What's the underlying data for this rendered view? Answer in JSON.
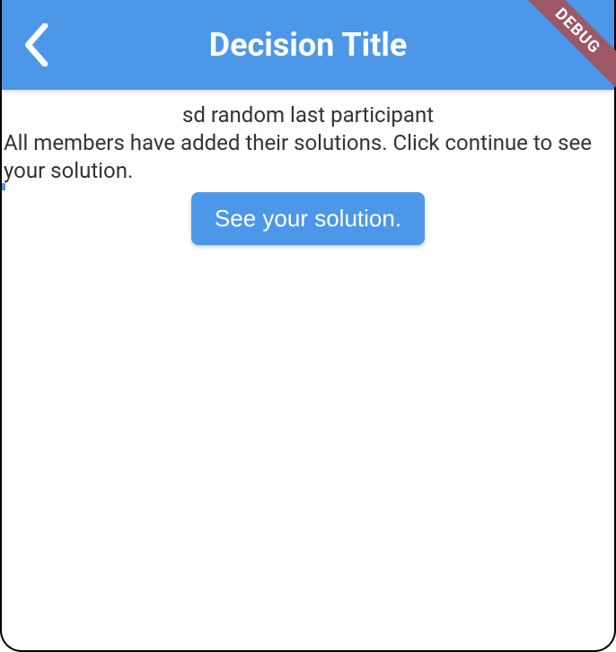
{
  "header": {
    "title": "Decision Title",
    "debug_label": "DEBUG"
  },
  "content": {
    "participant_line": "sd random last participant",
    "instruction": "All members have added their solutions. Click continue to see your solution.",
    "button_label": "See your solution."
  }
}
